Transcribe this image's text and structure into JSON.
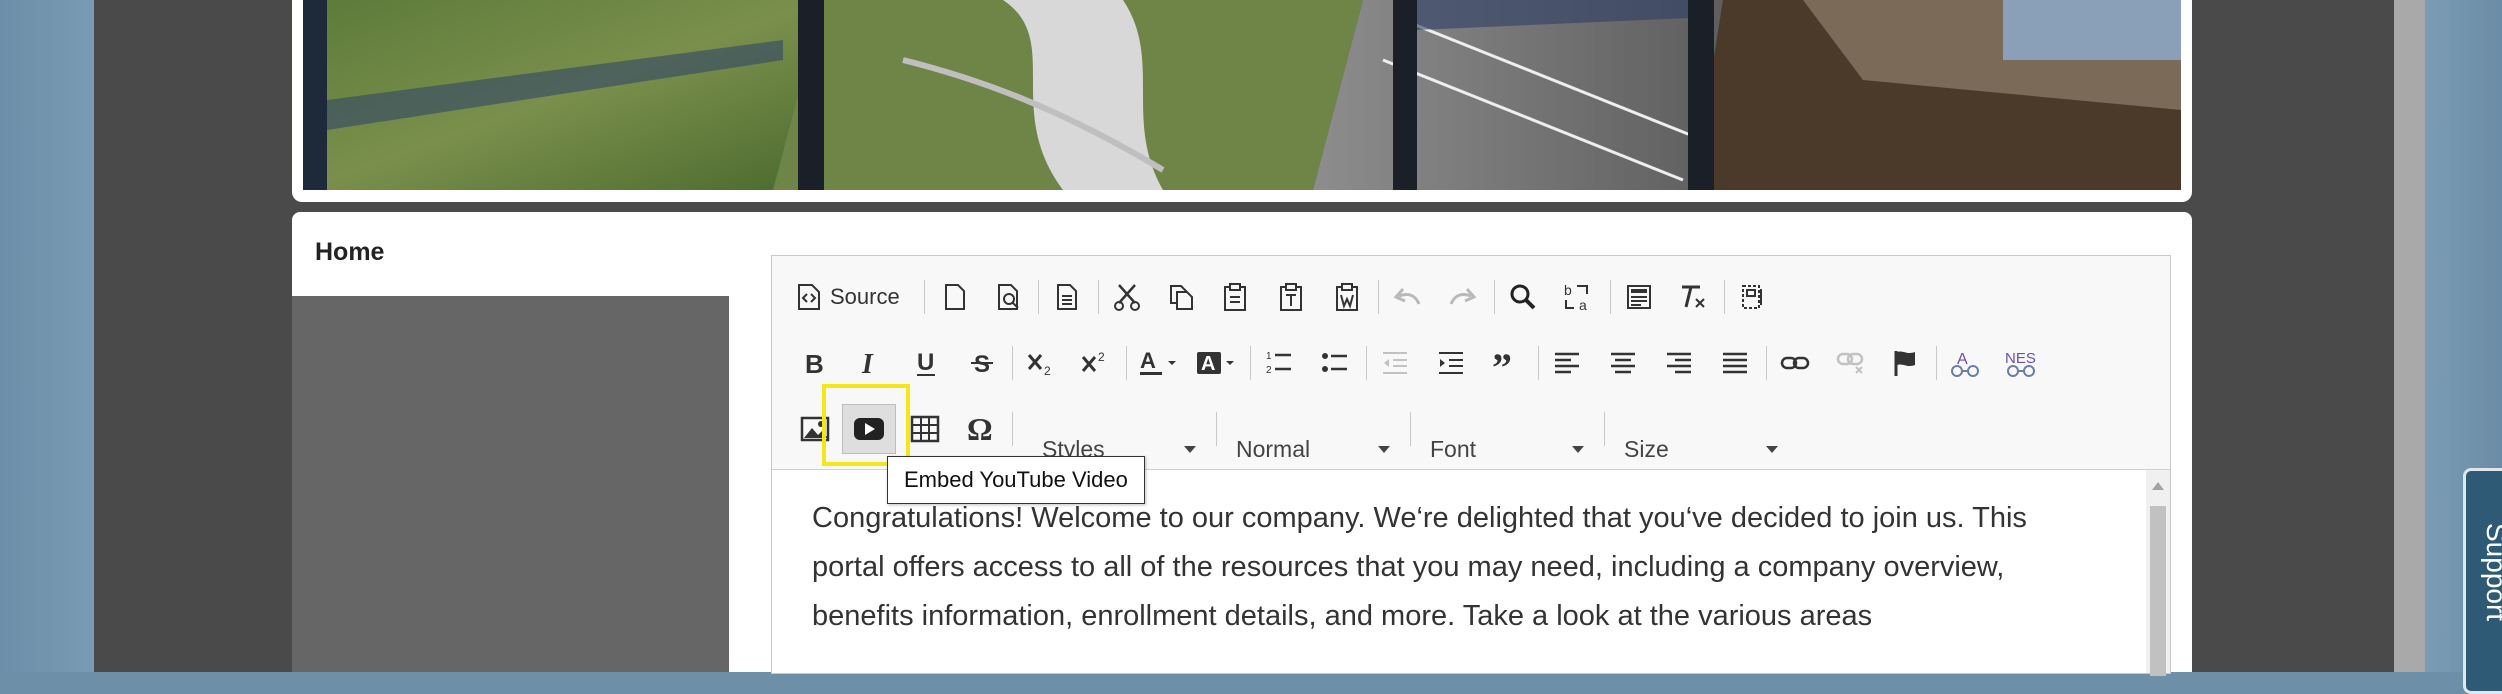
{
  "page": {
    "home_label": "Home"
  },
  "toolbar": {
    "source_label": "Source",
    "styles_label": "Styles",
    "format_label": "Normal",
    "font_label": "Font",
    "size_label": "Size",
    "tooltip": "Embed YouTube Video"
  },
  "editor": {
    "body_text": "Congratulations! Welcome to our company. We‘re delighted that you‘ve decided to join us. This portal offers access to all of the resources that you may need, including a company overview, benefits information, enrollment details, and more. Take a look at the various areas"
  },
  "support": {
    "label": "Support"
  },
  "icons": {
    "row1": [
      "source-icon",
      "new-page-icon",
      "preview-icon",
      "templates-icon",
      "cut-icon",
      "copy-icon",
      "paste-icon",
      "paste-text-icon",
      "paste-word-icon",
      "undo-icon",
      "redo-icon",
      "find-icon",
      "replace-icon",
      "select-all-icon",
      "remove-format-icon",
      "show-blocks-icon"
    ],
    "row2": [
      "bold-icon",
      "italic-icon",
      "underline-icon",
      "strike-icon",
      "subscript-icon",
      "superscript-icon",
      "text-color-icon",
      "bg-color-icon",
      "numbered-list-icon",
      "bulleted-list-icon",
      "outdent-icon",
      "indent-icon",
      "blockquote-icon",
      "align-left-icon",
      "align-center-icon",
      "align-right-icon",
      "justify-icon",
      "link-icon",
      "unlink-icon",
      "anchor-icon",
      "spellcheck-icon",
      "nes-icon"
    ],
    "row3": [
      "image-icon",
      "youtube-icon",
      "table-icon",
      "special-char-icon"
    ]
  },
  "colors": {
    "highlight": "#f5e61a",
    "support_bg": "#2f5a76",
    "shell": "#4a4a4a"
  }
}
